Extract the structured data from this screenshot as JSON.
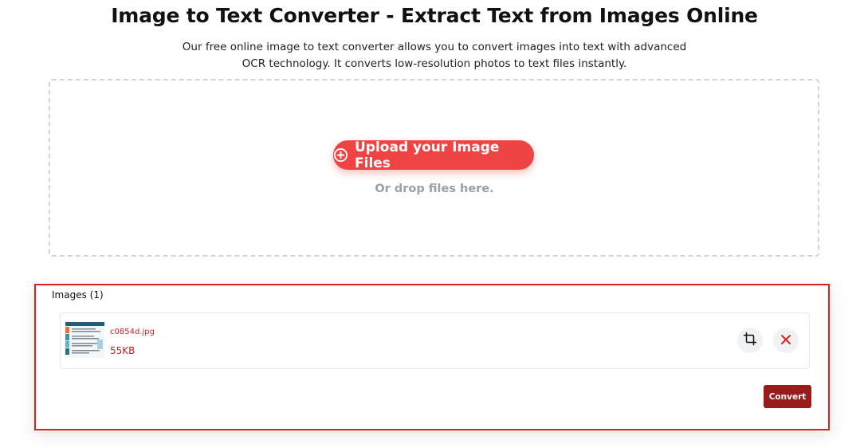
{
  "header": {
    "title": "Image to Text Converter - Extract Text from Images Online",
    "description_line1": "Our free online image to text converter allows you to convert images into text with advanced",
    "description_line2": "OCR technology. It converts low-resolution photos to text files instantly."
  },
  "upload": {
    "button_label": "Upload your Image Files",
    "button_icon": "plus-circle-icon",
    "drop_text": "Or drop files here."
  },
  "images_panel": {
    "label": "Images (1)",
    "files": [
      {
        "name": "c0854d.jpg",
        "size": "55KB",
        "thumbnail_icon": "image-thumbnail"
      }
    ],
    "crop_icon": "crop-icon",
    "remove_icon": "close-icon",
    "convert_label": "Convert"
  },
  "colors": {
    "accent": "#ef4444",
    "panel_border": "#e11d1d",
    "convert_button": "#991b1b",
    "file_text": "#c02626",
    "muted_text": "#9aa0a8"
  }
}
